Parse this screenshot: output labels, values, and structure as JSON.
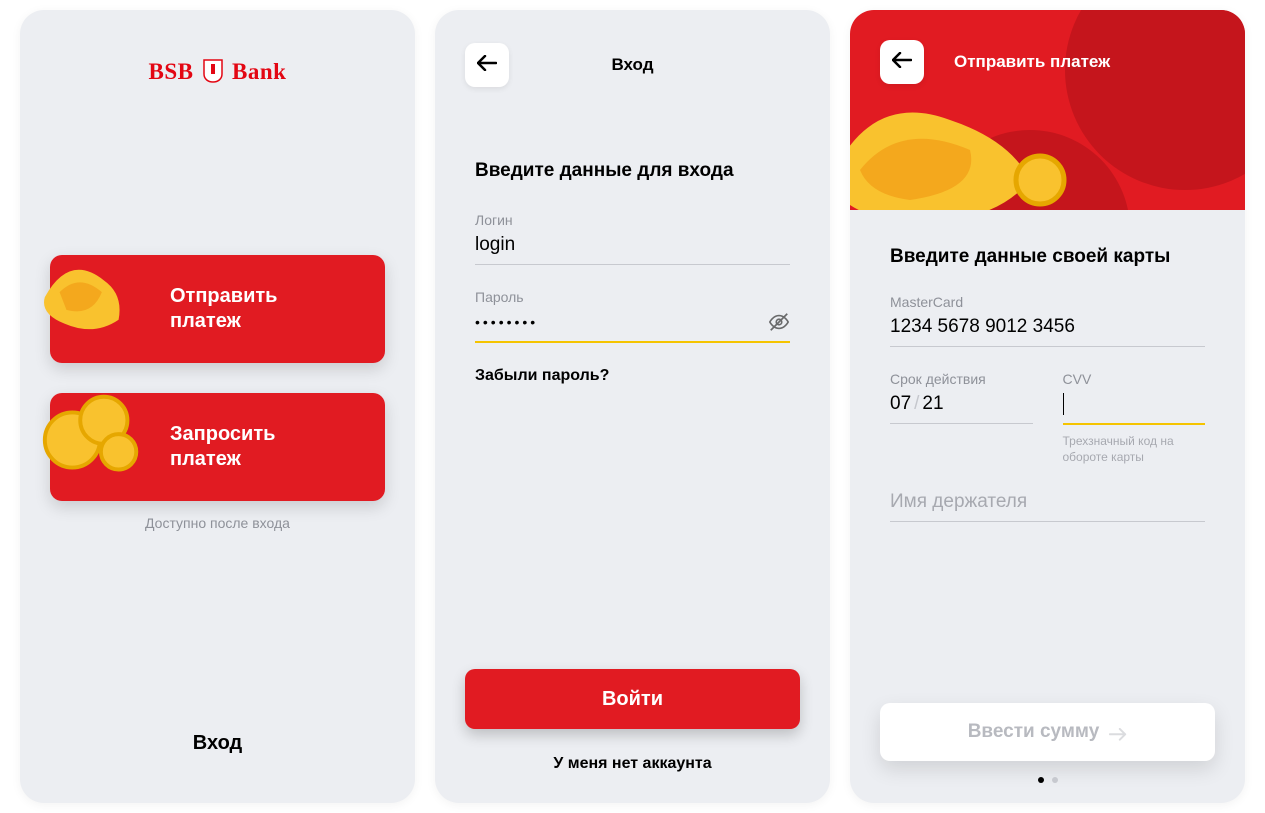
{
  "brand": {
    "name_left": "BSB",
    "name_right": "Bank"
  },
  "colors": {
    "accent_red": "#e11b22",
    "accent_yellow": "#f5c400"
  },
  "screen1": {
    "send_label": "Отправить\nплатеж",
    "request_label": "Запросить\nплатеж",
    "hint": "Доступно после входа",
    "login_link": "Вход"
  },
  "screen2": {
    "title": "Вход",
    "heading": "Введите данные для входа",
    "login_label": "Логин",
    "login_value": "login",
    "password_label": "Пароль",
    "password_value": "••••••••",
    "forgot": "Забыли пароль?",
    "submit": "Войти",
    "no_account": "У меня нет аккаунта"
  },
  "screen3": {
    "title": "Отправить платеж",
    "heading": "Введите данные своей карты",
    "card_type_label": "MasterCard",
    "card_number": "1234 5678 9012 3456",
    "expiry_label": "Срок действия",
    "expiry_month": "07",
    "expiry_year": "21",
    "cvv_label": "CVV",
    "cvv_hint": "Трехзначный код на обороте карты",
    "holder_placeholder": "Имя держателя",
    "next_button": "Ввести сумму",
    "pager": {
      "total": 2,
      "active_index": 0
    }
  }
}
